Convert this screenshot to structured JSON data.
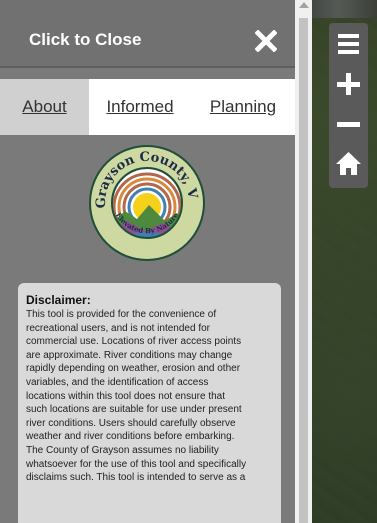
{
  "panel": {
    "header": {
      "title": "Click to Close"
    },
    "tabs": [
      {
        "label": "About",
        "active": true
      },
      {
        "label": "Informed",
        "active": false
      },
      {
        "label": "Planning",
        "active": false
      }
    ],
    "logo": {
      "top_text": "Grayson County, VA",
      "bottom_text": "Elevated By Nature"
    },
    "disclaimer": {
      "title": "Disclaimer:",
      "lines": [
        "This tool is provided for the convenience of",
        "recreational users, and is not intended for",
        "commercial use. Locations of river access points",
        "are approximate. River conditions may change",
        "rapidly depending on weather, erosion and other",
        "variables, and the identification of access",
        "locations within this tool does not ensure that",
        "such locations are suitable for use under present",
        "river conditions. Users should carefully observe",
        "weather and river conditions before embarking.",
        "The County of Grayson assumes no liability",
        "whatsoever for the use of this tool and specifically",
        "disclaims such. This tool is intended to serve as a"
      ]
    }
  },
  "map_controls": {
    "items": [
      "menu-icon",
      "zoom-in-icon",
      "zoom-out-icon",
      "home-icon"
    ]
  },
  "colors": {
    "panel_bg": "#7a7a7a",
    "header_bg": "#717171",
    "tab_active_bg": "#d0d0d0",
    "card_bg": "#d9d9d9",
    "control_bg": "#5a5a5a"
  }
}
